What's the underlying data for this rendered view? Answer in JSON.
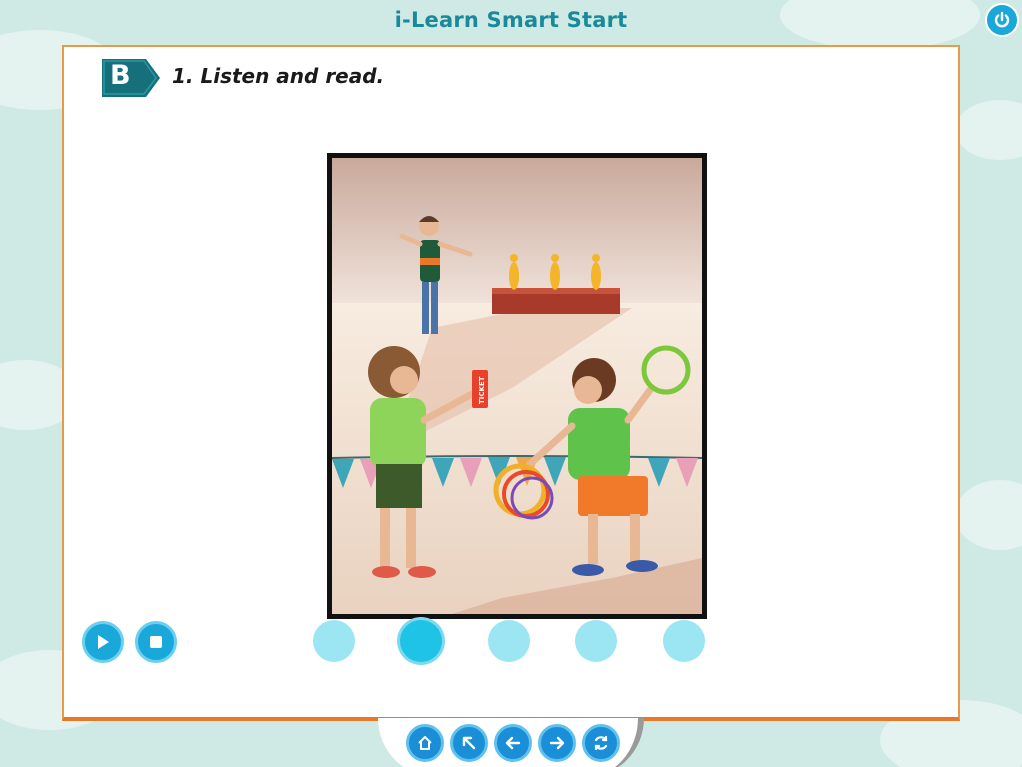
{
  "app": {
    "title": "i-Learn Smart Start"
  },
  "lesson": {
    "section_letter": "B",
    "instruction": "1. Listen and read."
  },
  "picture": {
    "ticket_text": "TICKET"
  },
  "controls": {
    "play_icon": "play-icon",
    "stop_icon": "stop-icon"
  },
  "pager": {
    "count": 5,
    "active_index": 2
  },
  "navigation": {
    "icons": [
      "home-icon",
      "back-to-start-icon",
      "previous-icon",
      "next-icon",
      "refresh-icon"
    ]
  },
  "colors": {
    "accent_blue": "#1aa7d9",
    "panel_border": "#e8772a",
    "title_teal": "#1a8a9a",
    "badge_teal": "#15707c"
  }
}
